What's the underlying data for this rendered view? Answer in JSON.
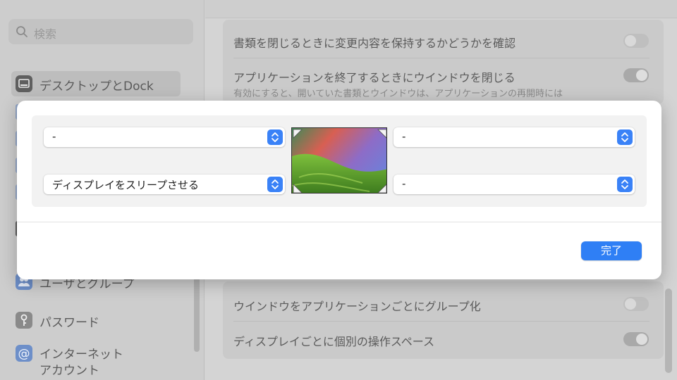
{
  "sidebar": {
    "search_placeholder": "検索",
    "items": [
      {
        "label": "デスクトップとDock",
        "active": true
      },
      {
        "label": "ユーザとグループ"
      },
      {
        "label": "パスワード"
      },
      {
        "label": "インターネット",
        "label2": "アカウント"
      }
    ]
  },
  "settings": {
    "rows": [
      {
        "label": "書類を閉じるときに変更内容を保持するかどうかを確認",
        "on": false
      },
      {
        "label": "アプリケーションを終了するときにウインドウを閉じる",
        "sub": "有効にすると、開いていた書類とウインドウは、アプリケーションの再開時には",
        "on": true
      },
      {
        "label": "ウインドウをアプリケーションごとにグループ化",
        "on": false
      },
      {
        "label": "ディスプレイごとに個別の操作スペース",
        "on": true
      }
    ]
  },
  "hot_corners": {
    "top_left": "-",
    "top_right": "-",
    "bottom_left": "ディスプレイをスリープさせる",
    "bottom_right": "-"
  },
  "done_label": "完了"
}
